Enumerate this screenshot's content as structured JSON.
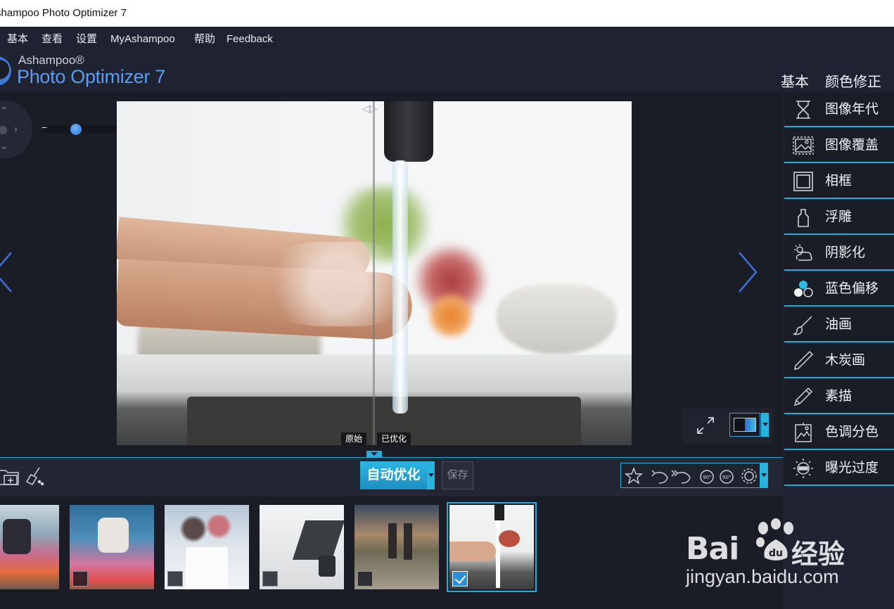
{
  "window": {
    "title": "shampoo Photo Optimizer 7"
  },
  "menu": [
    "基本",
    "查看",
    "设置",
    "MyAshampoo",
    "帮助",
    "Feedback"
  ],
  "logo": {
    "brand": "Ashampoo®",
    "product": "Photo Optimizer 7"
  },
  "header_tabs": [
    "基本",
    "颜色修正"
  ],
  "zoom": {
    "minus": "−",
    "plus": "+",
    "level": 0.3
  },
  "compare": {
    "original_label": "原始",
    "optimized_label": "已优化"
  },
  "toolbar": {
    "auto_optimize": "自动优化",
    "save": "保存"
  },
  "sidebar_items": [
    {
      "label": "图像年代",
      "icon": "hourglass-icon"
    },
    {
      "label": "图像覆盖",
      "icon": "image-overlay-icon"
    },
    {
      "label": "相框",
      "icon": "frame-icon"
    },
    {
      "label": "浮雕",
      "icon": "emboss-icon"
    },
    {
      "label": "阴影化",
      "icon": "shadow-icon"
    },
    {
      "label": "蓝色偏移",
      "icon": "blue-shift-icon"
    },
    {
      "label": "油画",
      "icon": "brush-icon"
    },
    {
      "label": "木炭画",
      "icon": "charcoal-icon"
    },
    {
      "label": "素描",
      "icon": "pencil-icon"
    },
    {
      "label": "色调分色",
      "icon": "posterize-icon"
    },
    {
      "label": "曝光过度",
      "icon": "overexpose-icon"
    }
  ],
  "thumbnails": [
    {
      "name": "jumper-1",
      "checked": false
    },
    {
      "name": "jumper-2",
      "checked": false
    },
    {
      "name": "brushes",
      "checked": false
    },
    {
      "name": "laptop-desk",
      "checked": false
    },
    {
      "name": "couple-walk",
      "checked": false
    },
    {
      "name": "hand-wash",
      "checked": true
    }
  ],
  "watermark": {
    "brand_a": "Bai",
    "brand_b": "经验",
    "url": "jingyan.baidu.com"
  },
  "colors": {
    "accent": "#2da9d6",
    "bg": "#1b1d26",
    "panel": "#1f2230"
  }
}
